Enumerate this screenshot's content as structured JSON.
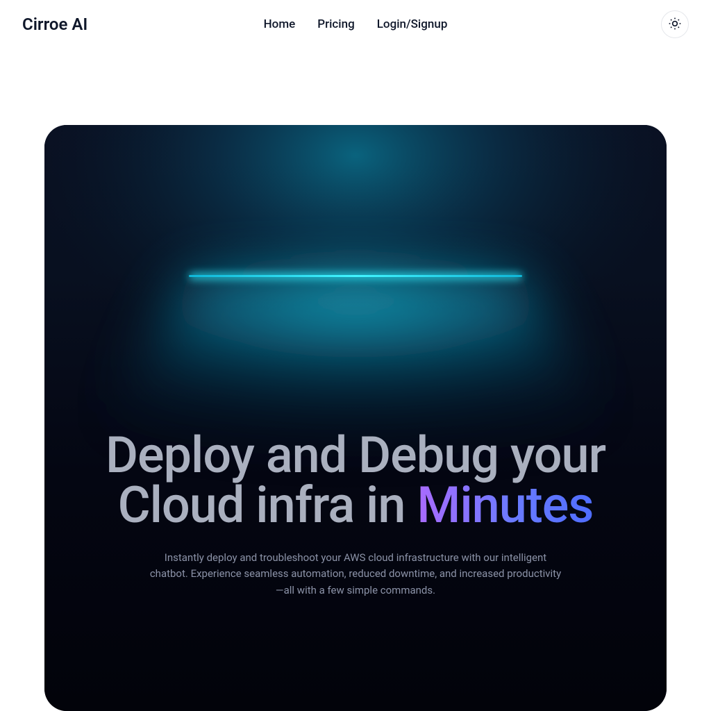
{
  "header": {
    "brand": "Cirroe AI",
    "nav": {
      "home": "Home",
      "pricing": "Pricing",
      "login": "Login/Signup"
    },
    "theme_toggle_icon": "sun-icon"
  },
  "hero": {
    "headline_prefix": "Deploy and Debug your Cloud infra in ",
    "headline_emphasis": "Minutes",
    "subtext": "Instantly deploy and troubleshoot your AWS cloud infrastructure with our intelligent chatbot. Experience seamless automation, reduced downtime, and increased productivity—all with a few simple commands."
  },
  "colors": {
    "panel_bg": "#090b18",
    "glow_cyan": "#1fe7ff",
    "headline": "#aab0bf",
    "gradient_start": "#a96bff",
    "gradient_end": "#4f6dff",
    "subtext": "#8b92a7"
  }
}
